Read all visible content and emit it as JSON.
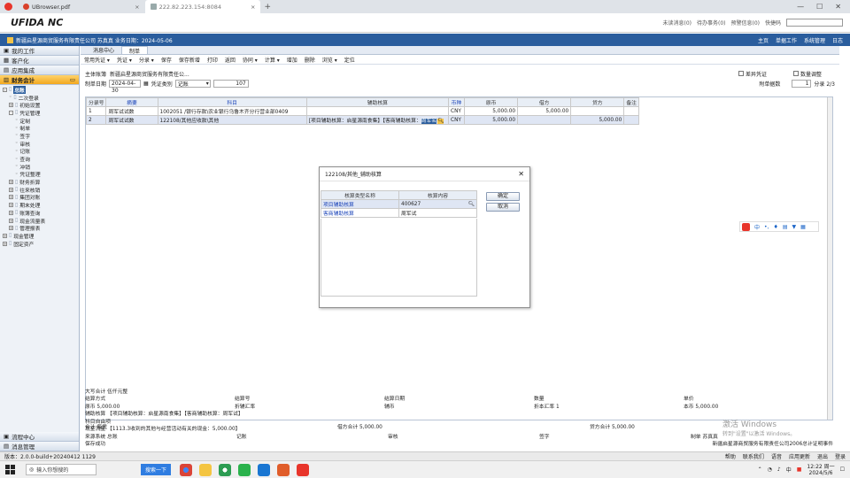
{
  "browser": {
    "tabs": [
      {
        "label": "UBrowser.pdf",
        "active": false
      },
      {
        "label": "222.82.223.154:8084",
        "active": true
      }
    ]
  },
  "app": {
    "logo": "UFIDA NC",
    "header_links": [
      "未读消息(0)",
      "待办事务(0)",
      "预警信息(0)",
      "快捷码"
    ],
    "company_line": "新疆启星源商贸服务有限责任公司 苏真真 业务日期：2024-05-06",
    "right_links": [
      "主页",
      "单据工作",
      "系统管理",
      "日志"
    ]
  },
  "sidebar": {
    "top_items": [
      "我的工作",
      "客户化",
      "应用集成"
    ],
    "active_section": "财务会计",
    "tree": [
      {
        "label": "总账",
        "level": 0,
        "box": "-",
        "selected": true
      },
      {
        "label": "二次登录",
        "level": 1,
        "box": ""
      },
      {
        "label": "初始设置",
        "level": 1,
        "box": "+"
      },
      {
        "label": "凭证管理",
        "level": 1,
        "box": "-"
      },
      {
        "label": "定制",
        "level": 2,
        "box": ""
      },
      {
        "label": "制单",
        "level": 2,
        "box": ""
      },
      {
        "label": "签字",
        "level": 2,
        "box": ""
      },
      {
        "label": "审核",
        "level": 2,
        "box": ""
      },
      {
        "label": "记账",
        "level": 2,
        "box": ""
      },
      {
        "label": "查询",
        "level": 2,
        "box": ""
      },
      {
        "label": "冲销",
        "level": 2,
        "box": ""
      },
      {
        "label": "凭证整理",
        "level": 2,
        "box": ""
      },
      {
        "label": "财务折算",
        "level": 1,
        "box": "+"
      },
      {
        "label": "往来核销",
        "level": 1,
        "box": "+"
      },
      {
        "label": "集团对账",
        "level": 1,
        "box": "+"
      },
      {
        "label": "期末处理",
        "level": 1,
        "box": "+"
      },
      {
        "label": "账簿查询",
        "level": 1,
        "box": "+"
      },
      {
        "label": "现金流量表",
        "level": 1,
        "box": "+"
      },
      {
        "label": "管理报表",
        "level": 1,
        "box": "+"
      },
      {
        "label": "现金管理",
        "level": 0,
        "box": "+"
      },
      {
        "label": "固定资产",
        "level": 0,
        "box": "+"
      }
    ],
    "bottom_items": [
      "流程中心",
      "消息管理"
    ]
  },
  "main": {
    "tabs": [
      "消息中心",
      "制单"
    ],
    "toolbar": [
      "常用凭证",
      "凭证",
      "分录",
      "保存",
      "保存新增",
      "打印",
      "返回",
      "协同",
      "计算",
      "增加",
      "删除",
      "浏览",
      "定位"
    ],
    "entity_label": "主体账簿",
    "entity_value": "新疆启星源商贸服务有限责任公...",
    "checkbox_error": "差异凭证",
    "checkbox_qty": "数量调整",
    "date_label": "制单日期",
    "date_value": "2024-04-30",
    "type_label": "凭证类别",
    "type_value": "记账",
    "voucher_no": "107",
    "attach_label": "附单据数",
    "attach_value": "1",
    "page_info": "分录 2/3",
    "columns": [
      "分录号",
      "摘要",
      "科目",
      "辅助核算",
      "币种",
      "原币",
      "借方",
      "贷方",
      "备注"
    ],
    "rows": [
      {
        "no": "1",
        "summary": "周军试试数",
        "account": "1002051 /银行存款\\农业银行乌鲁木齐分行营业部0409",
        "aux": "",
        "currency": "CNY",
        "orig": "5,000.00",
        "debit": "5,000.00",
        "credit": "",
        "note": ""
      },
      {
        "no": "2",
        "summary": "周军试试数",
        "account": "122108/其他应收款\\其他",
        "aux": "[项目辅助核算：启星源南食集】【客商辅助核算：",
        "aux_edit": "周军名",
        "currency": "CNY",
        "orig": "5,000.00",
        "debit": "",
        "credit": "5,000.00",
        "note": ""
      }
    ]
  },
  "summary": {
    "total_label": "合计 每凭",
    "debit_total": "借方合计 5,000.00",
    "credit_total": "贷方合计 5,000.00",
    "upper_total": "大写合计 伍仟元整",
    "fields": [
      [
        "结算方式",
        "结算号",
        "结算日期",
        "数量",
        "单价"
      ],
      [
        "原币 5,000.00",
        "折辅汇率",
        "辅币",
        "折本汇率 1",
        "本币 5,000.00"
      ]
    ],
    "aux_line": "辅助核算 【项目辅助核算：启星源南食集】【客商辅助核算：周军试】",
    "subject_line": "科目自由项",
    "cashflow_line": "现金流量 【1113.3收到的其他与经营活动有关的现金：5,000.00】",
    "signers": [
      "来源系统 总账",
      "记账",
      "审核",
      "签字",
      "制单 苏真真"
    ],
    "status": "保存成功",
    "status_right": "新疆启星源商贸服务有限责任公司2006总计证明事件"
  },
  "dialog": {
    "title": "122108/其他_辅助核算",
    "columns": [
      "核算类型名称",
      "核算内容"
    ],
    "rows": [
      {
        "name": "项目辅助核算",
        "value": "400627"
      },
      {
        "name": "客商辅助核算",
        "value": "周军试"
      }
    ],
    "ok": "确定",
    "cancel": "取消"
  },
  "footer": {
    "version": "版本：2.0.0-build+20240412 1129",
    "links": [
      "帮助",
      "联系我们",
      "语音"
    ],
    "right": [
      "应用更新",
      "退出",
      "登录"
    ]
  },
  "taskbar": {
    "search_placeholder": "输入你想搜的",
    "search_button": "搜索一下",
    "time": "12:22 周一",
    "date": "2024/5/6",
    "ime": "中"
  },
  "watermark": {
    "line1": "激活 Windows",
    "line2": "转到\"设置\"以激活 Windows。"
  },
  "colors": {
    "accent": "#2a5d9d",
    "selected": "#f2a81e",
    "row_select": "#dfe6f4"
  }
}
